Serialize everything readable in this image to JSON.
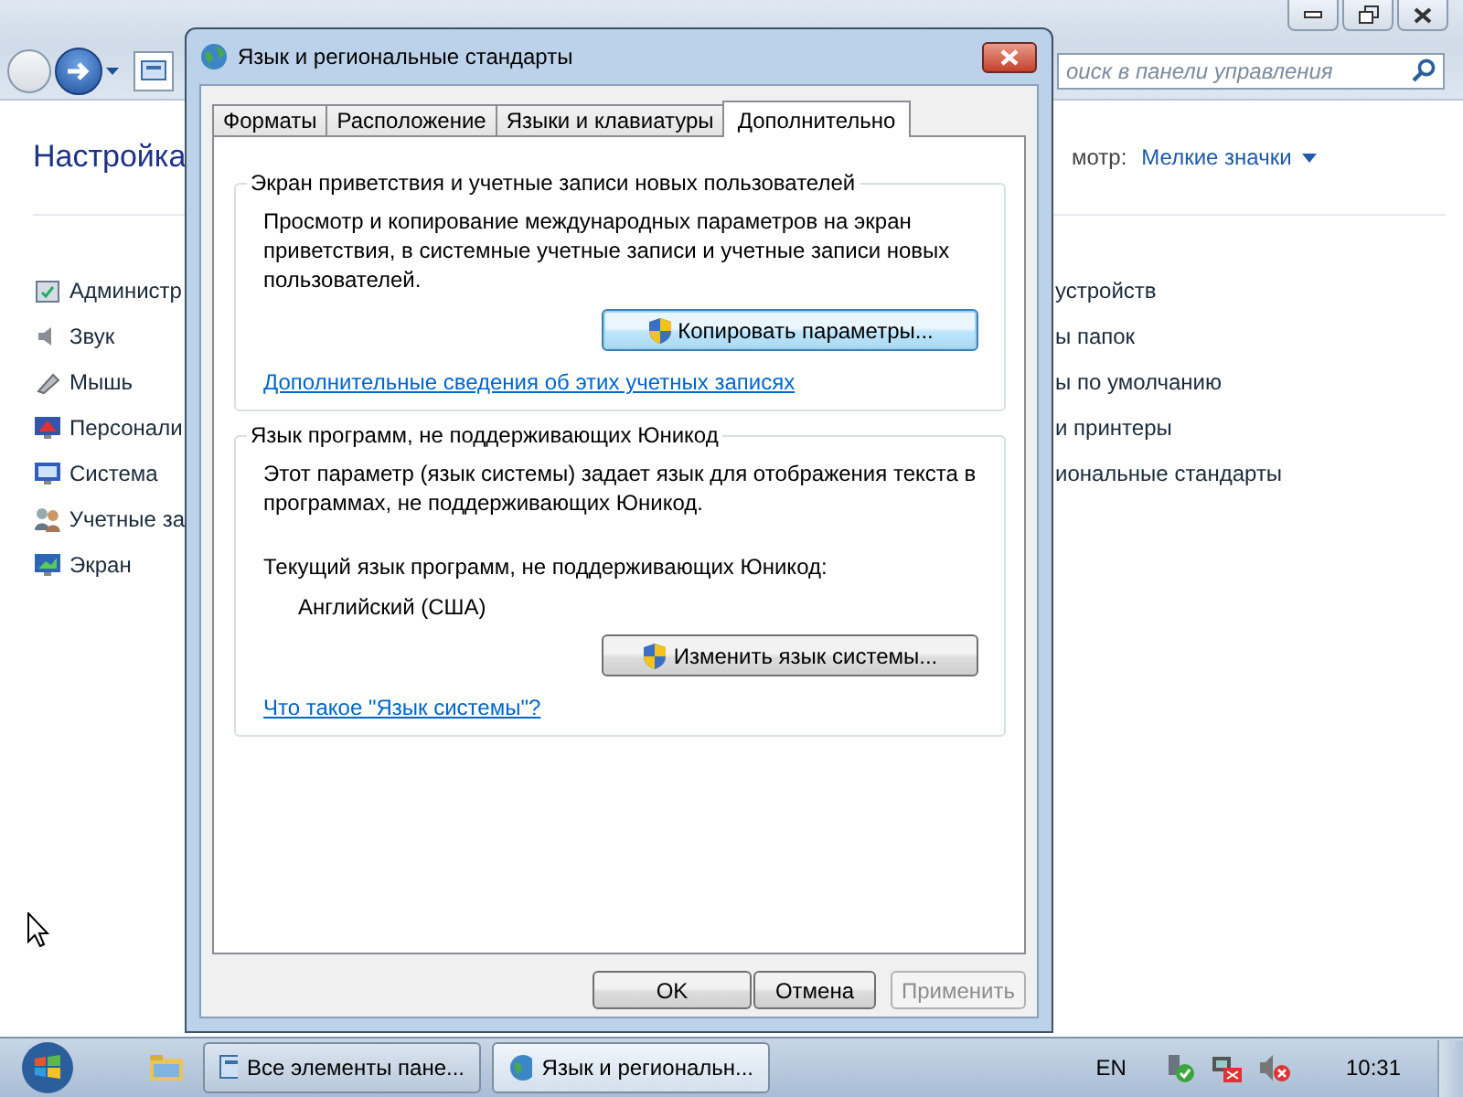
{
  "control_panel": {
    "search": {
      "placeholder": "оиск в панели управления"
    },
    "title": "Настройка",
    "view_label": "мотр:",
    "view_value": "Мелкие значки",
    "left_items": [
      "Администр",
      "Звук",
      "Мышь",
      "Персонали",
      "Система",
      "Учетные за",
      "Экран"
    ],
    "right_items": [
      "устройств",
      "ы папок",
      "ы по умолчанию",
      "и принтеры",
      "иональные стандарты"
    ]
  },
  "dialog": {
    "title": "Язык и региональные стандарты",
    "tabs": [
      {
        "label": "Форматы",
        "selected": false
      },
      {
        "label": "Расположение",
        "selected": false
      },
      {
        "label": "Языки и клавиатуры",
        "selected": false
      },
      {
        "label": "Дополнительно",
        "selected": true
      }
    ],
    "groups": [
      {
        "title": "Экран приветствия и учетные записи новых пользователей",
        "text": "Просмотр и копирование международных параметров на экран приветствия, в системные учетные записи и учетные записи новых пользователей.",
        "button": {
          "label": "Копировать параметры...",
          "focused": true
        },
        "link": "Дополнительные сведения об этих учетных записях"
      },
      {
        "title": "Язык программ, не поддерживающих Юникод",
        "text": "Этот параметр (язык системы) задает язык для отображения текста в программах, не поддерживающих Юникод.",
        "current_label": "Текущий язык программ, не поддерживающих Юникод:",
        "current_value": "Английский (США)",
        "button": {
          "label": "Изменить язык системы...",
          "focused": false
        },
        "link": "Что такое \"Язык системы\"?"
      }
    ],
    "buttons": [
      {
        "label": "OK",
        "disabled": false
      },
      {
        "label": "Отмена",
        "disabled": false
      },
      {
        "label": "Применить",
        "disabled": true
      }
    ]
  },
  "taskbar": {
    "tasks": [
      {
        "label": "Все элементы пане...",
        "selected": false
      },
      {
        "label": "Язык и региональн...",
        "selected": true
      }
    ],
    "language": "EN",
    "clock": "10:31"
  }
}
